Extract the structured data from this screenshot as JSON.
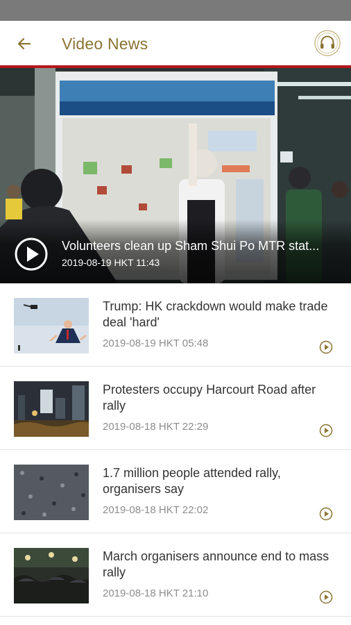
{
  "header": {
    "title": "Video News",
    "back_icon": "arrow-left-icon",
    "audio_icon": "headphones-icon",
    "accent_color": "#8a7434",
    "divider_color": "#b3181c"
  },
  "featured": {
    "title": "Volunteers clean up Sham Shui Po MTR stat...",
    "timestamp": "2019-08-19 HKT 11:43",
    "play_icon": "play-circle-icon"
  },
  "articles": [
    {
      "title": "Trump: HK crackdown would make trade deal 'hard'",
      "timestamp": "2019-08-19 HKT 05:48"
    },
    {
      "title": "Protesters occupy Harcourt Road after rally",
      "timestamp": "2019-08-18 HKT 22:29"
    },
    {
      "title": "1.7 million people attended rally, organisers say",
      "timestamp": "2019-08-18 HKT 22:02"
    },
    {
      "title": "March organisers announce end to mass rally",
      "timestamp": "2019-08-18 HKT 21:10"
    }
  ]
}
